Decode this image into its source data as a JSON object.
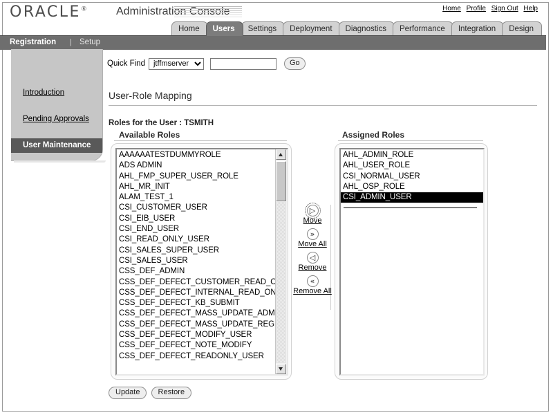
{
  "branding": {
    "logo_text": "ORACLE",
    "trademark": "®",
    "app_title": "Administration Console"
  },
  "global_links": [
    {
      "label": "Home",
      "name": "global-link-home"
    },
    {
      "label": "Profile",
      "name": "global-link-profile"
    },
    {
      "label": "Sign Out",
      "name": "global-link-signout"
    },
    {
      "label": "Help",
      "name": "global-link-help"
    }
  ],
  "tabs": [
    {
      "label": "Home",
      "selected": false
    },
    {
      "label": "Users",
      "selected": true
    },
    {
      "label": "Settings",
      "selected": false
    },
    {
      "label": "Deployment",
      "selected": false
    },
    {
      "label": "Diagnostics",
      "selected": false
    },
    {
      "label": "Performance",
      "selected": false
    },
    {
      "label": "Integration",
      "selected": false
    },
    {
      "label": "Design",
      "selected": false
    }
  ],
  "subnav": {
    "active_label": "Registration",
    "divider": "|",
    "second_label": "Setup"
  },
  "sidebar": {
    "items": [
      {
        "label": "Introduction",
        "selected": false
      },
      {
        "label": "Pending Approvals",
        "selected": false
      },
      {
        "label": "User Maintenance",
        "selected": true
      }
    ]
  },
  "quick_find": {
    "label": "Quick Find",
    "selected_option": "jtffmserver",
    "options": [
      "jtffmserver"
    ],
    "input_value": "",
    "input_placeholder": "",
    "go_label": "Go"
  },
  "main": {
    "page_title": "User-Role Mapping",
    "user_line": "Roles for the User : TSMITH",
    "available_heading": "Available Roles",
    "assigned_heading": "Assigned Roles",
    "available_roles": [
      "AAAAAATESTDUMMYROLE",
      "ADS ADMIN",
      "AHL_FMP_SUPER_USER_ROLE",
      "AHL_MR_INIT",
      "ALAM_TEST_1",
      "CSI_CUSTOMER_USER",
      "CSI_EIB_USER",
      "CSI_END_USER",
      "CSI_READ_ONLY_USER",
      "CSI_SALES_SUPER_USER",
      "CSI_SALES_USER",
      "CSS_DEF_ADMIN",
      "CSS_DEF_DEFECT_CUSTOMER_READ_ONLY",
      "CSS_DEF_DEFECT_INTERNAL_READ_ONLY",
      "CSS_DEF_DEFECT_KB_SUBMIT",
      "CSS_DEF_DEFECT_MASS_UPDATE_ADMIN",
      "CSS_DEF_DEFECT_MASS_UPDATE_REG",
      "CSS_DEF_DEFECT_MODIFY_USER",
      "CSS_DEF_DEFECT_NOTE_MODIFY",
      "CSS_DEF_DEFECT_READONLY_USER"
    ],
    "assigned_roles": [
      {
        "label": "AHL_ADMIN_ROLE",
        "selected": false
      },
      {
        "label": "AHL_USER_ROLE",
        "selected": false
      },
      {
        "label": "CSI_NORMAL_USER",
        "selected": false
      },
      {
        "label": "AHL_OSP_ROLE",
        "selected": false
      },
      {
        "label": "CSI_ADMIN_USER",
        "selected": true
      }
    ],
    "transfer_buttons": [
      {
        "glyph": "▷",
        "label": "Move",
        "icon_name": "move-right-icon",
        "focused": true
      },
      {
        "glyph": "»",
        "label": "Move All",
        "icon_name": "move-all-right-icon",
        "focused": false
      },
      {
        "glyph": "◁",
        "label": "Remove",
        "icon_name": "remove-left-icon",
        "focused": false
      },
      {
        "glyph": "«",
        "label": "Remove All",
        "icon_name": "remove-all-left-icon",
        "focused": false
      }
    ],
    "update_label": "Update",
    "restore_label": "Restore"
  },
  "colors": {
    "selected_tab": "#7c7c7c",
    "subnav_bg": "#6e6e6e",
    "sidebar_bg": "#c6c6c6",
    "sidebar_selected": "#595959",
    "list_selected": "#000000"
  }
}
